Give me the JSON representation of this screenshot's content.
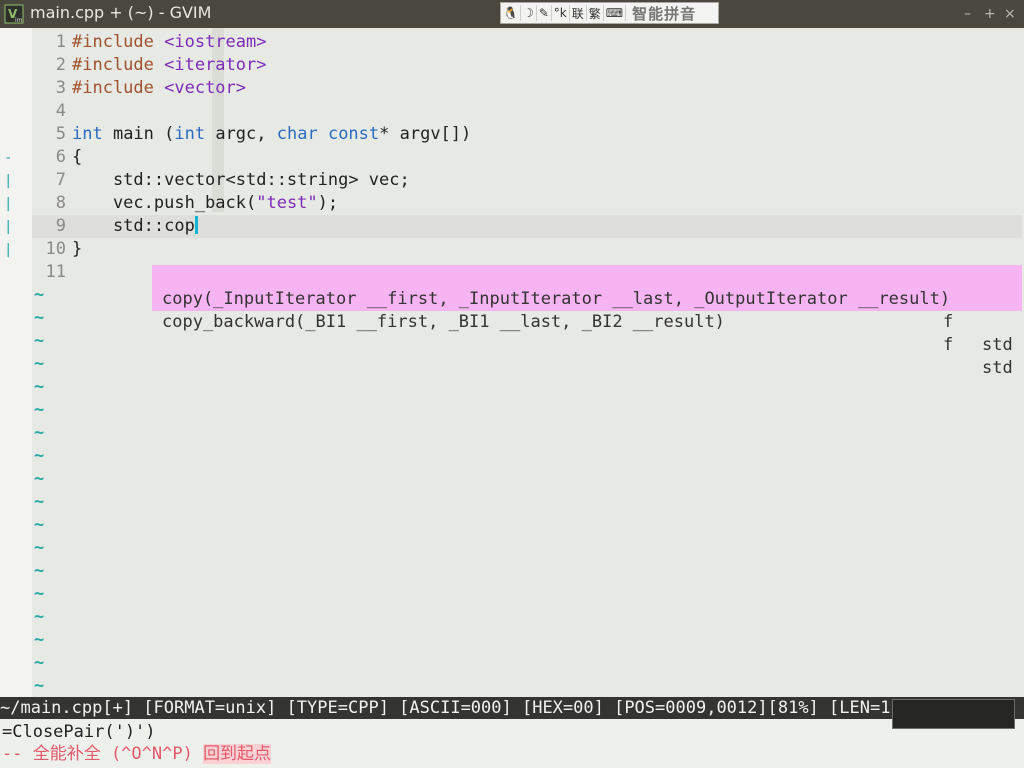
{
  "window": {
    "title": "main.cpp + (~) - GVIM",
    "app_icon": "vim-icon",
    "minimize_glyph": "–",
    "maximize_glyph": "+",
    "close_glyph": "×"
  },
  "ime_bar": {
    "items": [
      {
        "icon": "penguin-icon",
        "glyph": "🐧"
      },
      {
        "icon": "moon-icon",
        "glyph": "☽"
      },
      {
        "icon": "brush-icon",
        "glyph": "✎"
      },
      {
        "icon": "punct-icon",
        "glyph": "°k"
      },
      {
        "icon": "lianxiang-icon",
        "glyph": "联"
      },
      {
        "icon": "fanti-icon",
        "glyph": "繁"
      },
      {
        "icon": "keyboard-icon",
        "glyph": "⌨"
      }
    ],
    "label": "智能拼音"
  },
  "code": {
    "lines": [
      {
        "n": "1",
        "parts": [
          {
            "t": "#include ",
            "c": "pp"
          },
          {
            "t": "<iostream>",
            "c": "str"
          }
        ]
      },
      {
        "n": "2",
        "parts": [
          {
            "t": "#include ",
            "c": "pp"
          },
          {
            "t": "<iterator>",
            "c": "str"
          }
        ]
      },
      {
        "n": "3",
        "parts": [
          {
            "t": "#include ",
            "c": "pp"
          },
          {
            "t": "<vector>",
            "c": "str"
          }
        ]
      },
      {
        "n": "4",
        "parts": []
      },
      {
        "n": "5",
        "parts": [
          {
            "t": "int",
            "c": "kw"
          },
          {
            "t": " main (",
            "c": ""
          },
          {
            "t": "int",
            "c": "kw"
          },
          {
            "t": " argc, ",
            "c": ""
          },
          {
            "t": "char",
            "c": "kw"
          },
          {
            "t": " ",
            "c": ""
          },
          {
            "t": "const",
            "c": "kw"
          },
          {
            "t": "* argv[])",
            "c": ""
          }
        ]
      },
      {
        "n": "6",
        "parts": [
          {
            "t": "{",
            "c": ""
          }
        ]
      },
      {
        "n": "7",
        "parts": [
          {
            "t": "    std::vector<std::string> vec;",
            "c": ""
          }
        ]
      },
      {
        "n": "8",
        "parts": [
          {
            "t": "    vec.push_back(",
            "c": ""
          },
          {
            "t": "\"test\"",
            "c": "str"
          },
          {
            "t": ");",
            "c": ""
          }
        ]
      },
      {
        "n": "9",
        "parts": [
          {
            "t": "    std::cop",
            "c": ""
          }
        ]
      },
      {
        "n": "10",
        "parts": [
          {
            "t": "}",
            "c": ""
          }
        ]
      },
      {
        "n": "11",
        "parts": []
      }
    ],
    "current_line_number": "9",
    "signs": [
      "-",
      "|",
      "|",
      "|",
      "|"
    ],
    "tilde_glyph": "~",
    "tilde_count": 18
  },
  "completion_popup": {
    "items": [
      {
        "word": "copy(_InputIterator __first, _InputIterator __last, _OutputIterator __result)",
        "kind": "f",
        "menu": "std"
      },
      {
        "word": "copy_backward(_BI1 __first, _BI1 __last, _BI2 __result)",
        "kind": "f",
        "menu": "std"
      }
    ]
  },
  "statusline": {
    "text": "~/main.cpp[+] [FORMAT=unix] [TYPE=CPP] [ASCII=000] [HEX=00] [POS=0009,0012][81%] [LEN=11]"
  },
  "cmdline": {
    "text": "=ClosePair(')')"
  },
  "modeline": {
    "prefix": "-- 全能补全 (^O^N^P) ",
    "message": "回到起点"
  },
  "colors": {
    "keyword": "#2a6cc0",
    "preproc": "#a0522d",
    "string": "#7d2bb8",
    "popup_bg": "#f7b4f2",
    "tilde": "#27a8a8",
    "cursor": "#16b4d4"
  }
}
